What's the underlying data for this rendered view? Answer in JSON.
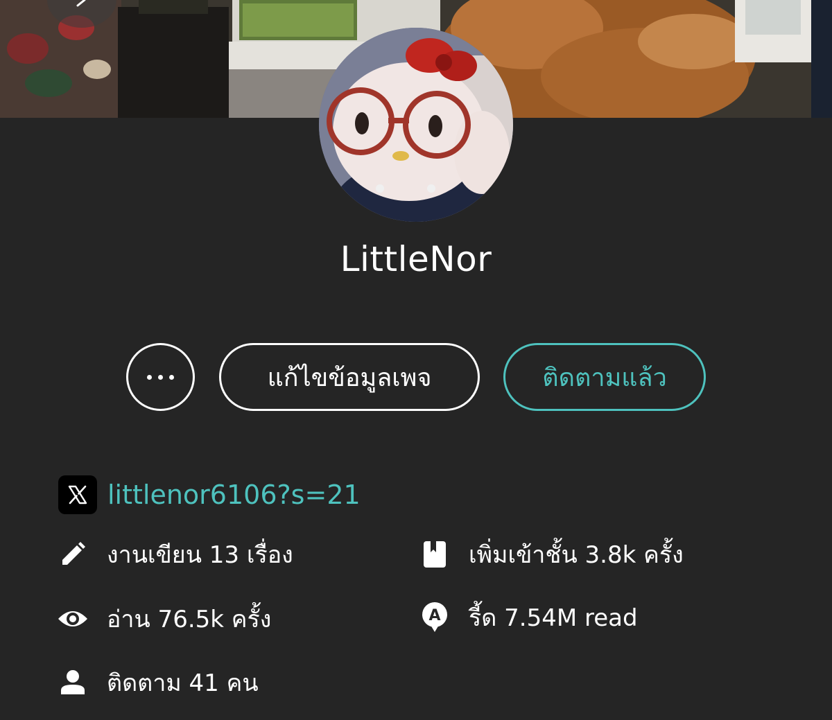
{
  "profile": {
    "name": "LittleNor"
  },
  "actions": {
    "edit_label": "แก้ไขข้อมูลเพจ",
    "follow_label": "ติดตามแล้ว"
  },
  "social": {
    "link_text": "littlenor6106?s=21",
    "icon": "x-logo-icon"
  },
  "stats": {
    "works": "งานเขียน 13 เรื่อง",
    "reads": "อ่าน 76.5k ครั้ง",
    "following": "ติดตาม 41 คน",
    "shelf_adds": "เพิ่มเข้าชั้น 3.8k ครั้ง",
    "read_count": "รี้ด 7.54M read"
  },
  "icons": {
    "more": "ellipsis-icon",
    "pencil": "pencil-icon",
    "eye": "eye-icon",
    "person": "person-icon",
    "book": "book-icon",
    "read_badge": "speech-bubble-a-icon",
    "back": "chevron-left-icon"
  },
  "colors": {
    "background": "#252525",
    "accent": "#4ec2be",
    "text": "#ffffff"
  }
}
